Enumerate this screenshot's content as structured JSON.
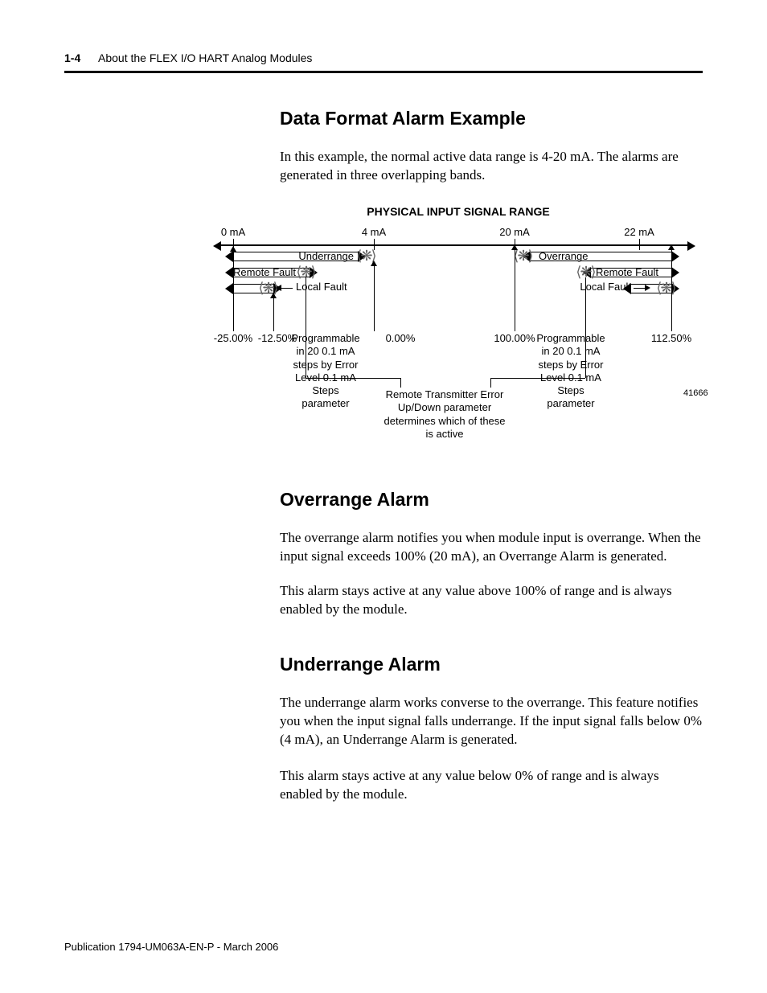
{
  "header": {
    "page_number": "1-4",
    "running_title": "About the FLEX I/O HART Analog Modules"
  },
  "footer": {
    "publication": "Publication 1794-UM063A-EN-P - March 2006"
  },
  "sections": {
    "ex_title": "Data Format Alarm Example",
    "ex_body": "In this example, the normal active data range is 4-20 mA. The alarms are generated in three overlapping bands.",
    "over_title": "Overrange Alarm",
    "over_p1": "The overrange alarm notifies you when module input is overrange. When the input signal exceeds 100% (20 mA), an Overrange Alarm is generated.",
    "over_p2": "This alarm stays active at any value above 100% of range and is always enabled by the module.",
    "under_title": "Underrange Alarm",
    "under_p1": "The underrange alarm works converse to the overrange. This feature notifies you when the input signal falls underrange. If the input signal falls below 0% (4 mA), an Underrange Alarm is generated.",
    "under_p2": "This alarm stays active at any value below 0% of range and is always enabled by the module."
  },
  "diagram": {
    "title": "PHYSICAL INPUT SIGNAL RANGE",
    "top_scale": {
      "t0": "0 mA",
      "t4": "4 mA",
      "t20": "20 mA",
      "t22": "22 mA"
    },
    "under_label": "Underrange",
    "over_label": "Overrange",
    "remote_fault_l": "Remote Fault",
    "remote_fault_r": "Remote Fault",
    "local_fault_l": "Local\nFault",
    "local_fault_r": "Local\nFault",
    "pct": {
      "m25": "-25.00%",
      "m125": "-12.50%",
      "z": "0.00%",
      "h": "100.00%",
      "p1125": "112.50%"
    },
    "prog_l": "Programmable\nin 20 0.1 mA\nsteps by Error\nLevel 0.1 mA\nSteps\nparameter",
    "prog_r": "Programmable\nin 20 0.1 mA\nsteps by Error\nLevel 0.1 mA\nSteps\nparameter",
    "remote_note": "Remote Transmitter Error\nUp/Down parameter\ndetermines which of these\nis active",
    "fig_num": "41666"
  }
}
